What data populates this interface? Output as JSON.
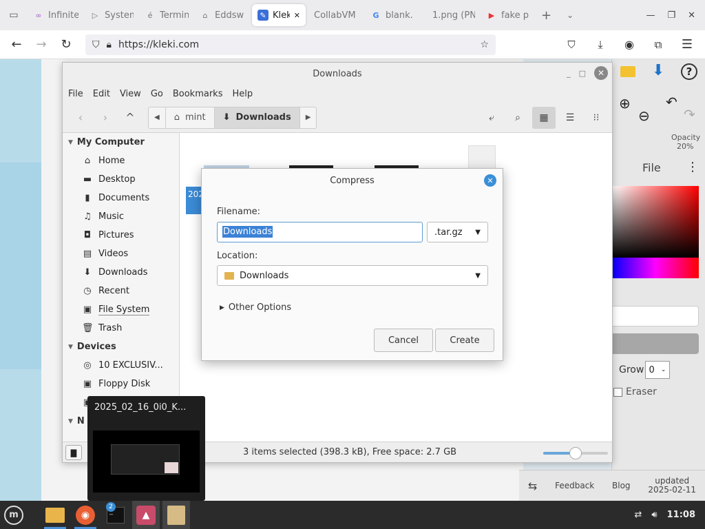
{
  "browser": {
    "tabs": [
      {
        "label": "Infinite",
        "icon": "infinity-icon"
      },
      {
        "label": "System",
        "icon": "play-icon"
      },
      {
        "label": "Termin",
        "icon": "e-icon"
      },
      {
        "label": "Eddsw",
        "icon": "bridge-icon"
      },
      {
        "label": "Kleki",
        "icon": "kleki-icon",
        "active": true
      },
      {
        "label": "CollabVM",
        "icon": ""
      },
      {
        "label": "blank.",
        "icon": "google-icon"
      },
      {
        "label": "1.png (PN",
        "icon": ""
      },
      {
        "label": "fake p",
        "icon": "youtube-icon"
      }
    ],
    "url": "https://kleki.com"
  },
  "kleki": {
    "opacity_label": "Opacity",
    "opacity_value": "20%",
    "file_label": "File",
    "grow_label": "Grow",
    "grow_value": "0",
    "eraser_label": "Eraser",
    "footer": {
      "feedback": "Feedback",
      "blog": "Blog",
      "updated_label": "updated",
      "updated_date": "2025-02-11"
    }
  },
  "file_manager": {
    "title": "Downloads",
    "menu": [
      "File",
      "Edit",
      "View",
      "Go",
      "Bookmarks",
      "Help"
    ],
    "breadcrumbs": [
      {
        "label": "mint",
        "icon": "home-icon"
      },
      {
        "label": "Downloads",
        "icon": "download-icon"
      }
    ],
    "sidebar": {
      "my_computer": {
        "title": "My Computer",
        "items": [
          {
            "label": "Home",
            "icon": "home-icon"
          },
          {
            "label": "Desktop",
            "icon": "desktop-icon"
          },
          {
            "label": "Documents",
            "icon": "document-icon"
          },
          {
            "label": "Music",
            "icon": "music-icon"
          },
          {
            "label": "Pictures",
            "icon": "camera-icon"
          },
          {
            "label": "Videos",
            "icon": "film-icon"
          },
          {
            "label": "Downloads",
            "icon": "download-icon"
          },
          {
            "label": "Recent",
            "icon": "clock-icon"
          },
          {
            "label": "File System",
            "icon": "drive-icon"
          },
          {
            "label": "Trash",
            "icon": "trash-icon"
          }
        ]
      },
      "devices": {
        "title": "Devices",
        "items": [
          {
            "label": "10 EXCLUSIV...",
            "icon": "disc-icon"
          },
          {
            "label": "Floppy Disk",
            "icon": "floppy-icon"
          }
        ]
      },
      "network_partial": "N"
    },
    "selected_file_partial": "202",
    "status": "3 items selected (398.3 kB), Free space: 2.7 GB",
    "zoom_fraction": 0.5
  },
  "dialog": {
    "title": "Compress",
    "filename_label": "Filename:",
    "filename_value": "Downloads",
    "extension": ".tar.gz",
    "location_label": "Location:",
    "location_value": "Downloads",
    "other_options": "Other Options",
    "cancel": "Cancel",
    "create": "Create"
  },
  "preview": {
    "title": "2025_02_16_0i0_K..."
  },
  "taskbar": {
    "clock": "11:08",
    "badge": "2"
  }
}
